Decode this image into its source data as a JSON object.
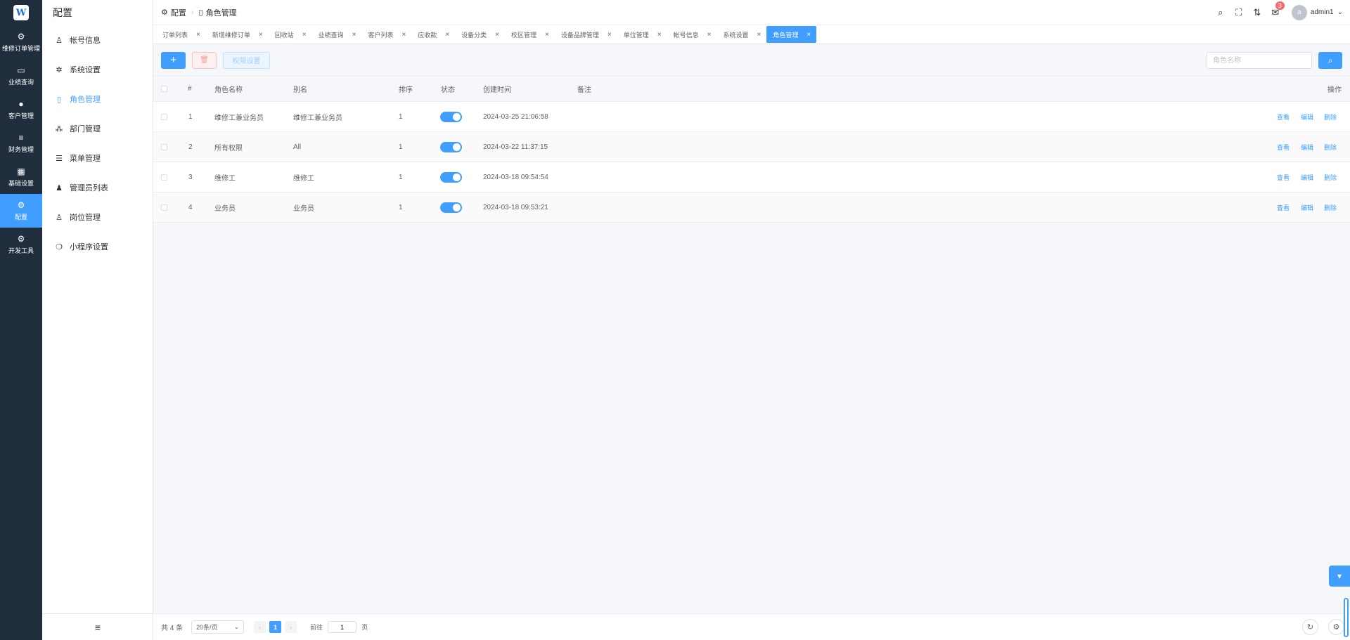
{
  "rail": {
    "logo_text": "W",
    "items": [
      {
        "label": "维修订单管理",
        "icon": "chip-icon",
        "glyph": "⚙"
      },
      {
        "label": "业绩查询",
        "icon": "chart-icon",
        "glyph": "▭"
      },
      {
        "label": "客户管理",
        "icon": "user-icon",
        "glyph": "●"
      },
      {
        "label": "财务管理",
        "icon": "database-icon",
        "glyph": "≡"
      },
      {
        "label": "基础设置",
        "icon": "grid-icon",
        "glyph": "▦"
      },
      {
        "label": "配置",
        "icon": "gear-icon",
        "glyph": "⚙"
      },
      {
        "label": "开发工具",
        "icon": "gear-icon",
        "glyph": "⚙"
      }
    ]
  },
  "submenu": {
    "title": "配置",
    "items": [
      {
        "label": "帐号信息",
        "icon": "user-outline-icon",
        "glyph": "♙"
      },
      {
        "label": "系统设置",
        "icon": "gear-icon",
        "glyph": "✲"
      },
      {
        "label": "角色管理",
        "icon": "book-icon",
        "glyph": "▯"
      },
      {
        "label": "部门管理",
        "icon": "org-icon",
        "glyph": "⁂"
      },
      {
        "label": "菜单管理",
        "icon": "list-icon",
        "glyph": "☰"
      },
      {
        "label": "管理员列表",
        "icon": "user-icon",
        "glyph": "♟"
      },
      {
        "label": "岗位管理",
        "icon": "user-outline-icon",
        "glyph": "♙"
      },
      {
        "label": "小程序设置",
        "icon": "wechat-icon",
        "glyph": "❍"
      }
    ],
    "collapse_glyph": "≡"
  },
  "header": {
    "breadcrumb": [
      "配置",
      "角色管理"
    ],
    "user": "admin1",
    "avatar_letter": "a",
    "badge": "3"
  },
  "tabs": [
    {
      "label": "订单列表"
    },
    {
      "label": "新增维修订单"
    },
    {
      "label": "回收站"
    },
    {
      "label": "业绩查询"
    },
    {
      "label": "客户列表"
    },
    {
      "label": "应收款"
    },
    {
      "label": "设备分类"
    },
    {
      "label": "校区管理"
    },
    {
      "label": "设备品牌管理"
    },
    {
      "label": "单位管理"
    },
    {
      "label": "帐号信息"
    },
    {
      "label": "系统设置"
    },
    {
      "label": "角色管理",
      "active": true
    }
  ],
  "toolbar": {
    "add_label": "+",
    "delete_glyph": "🗑",
    "perm_label": "权限设置",
    "search_placeholder": "角色名称"
  },
  "table": {
    "columns": {
      "index": "#",
      "name": "角色名称",
      "alias": "别名",
      "sort": "排序",
      "status": "状态",
      "created": "创建时间",
      "remark": "备注",
      "ops": "操作"
    },
    "rows": [
      {
        "index": "1",
        "name": "维修工兼业务员",
        "alias": "维修工兼业务员",
        "sort": "1",
        "status": true,
        "created": "2024-03-25 21:06:58",
        "remark": ""
      },
      {
        "index": "2",
        "name": "所有权限",
        "alias": "All",
        "sort": "1",
        "status": true,
        "created": "2024-03-22 11:37:15",
        "remark": ""
      },
      {
        "index": "3",
        "name": "维修工",
        "alias": "维修工",
        "sort": "1",
        "status": true,
        "created": "2024-03-18 09:54:54",
        "remark": ""
      },
      {
        "index": "4",
        "name": "业务员",
        "alias": "业务员",
        "sort": "1",
        "status": true,
        "created": "2024-03-18 09:53:21",
        "remark": ""
      }
    ],
    "op_view": "查看",
    "op_edit": "编辑",
    "op_delete": "删除"
  },
  "footer": {
    "total": "共 4 条",
    "page_size": "20条/页",
    "current_page": "1",
    "goto_prefix": "前往",
    "goto_value": "1",
    "goto_suffix": "页"
  },
  "colors": {
    "primary": "#409eff",
    "rail_bg": "#1f2d3d",
    "danger": "#f56c6c"
  }
}
